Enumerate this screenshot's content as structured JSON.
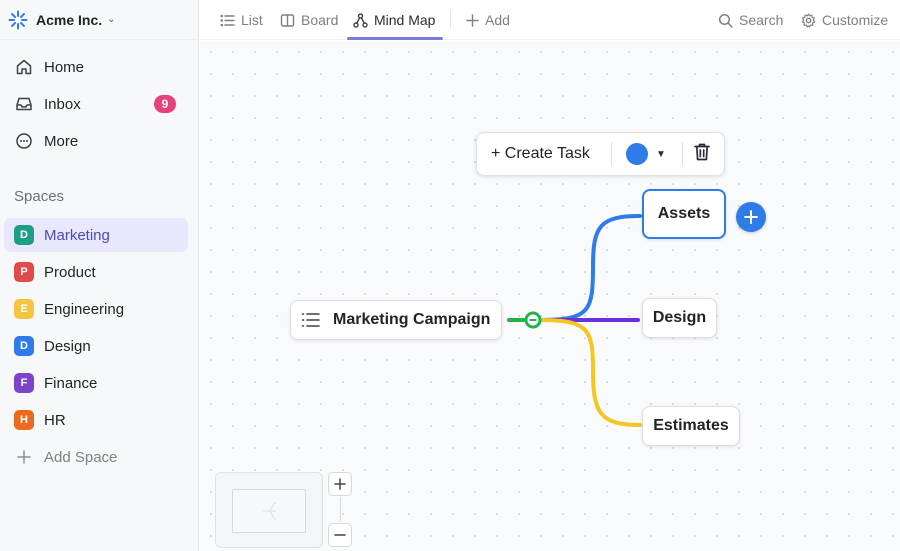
{
  "workspace": {
    "name": "Acme Inc."
  },
  "nav": {
    "home": "Home",
    "inbox": "Inbox",
    "inbox_count": "9",
    "more": "More"
  },
  "spaces": {
    "title": "Spaces",
    "items": [
      {
        "initial": "D",
        "label": "Marketing",
        "color": "#1e9e86"
      },
      {
        "initial": "P",
        "label": "Product",
        "color": "#e04b4b"
      },
      {
        "initial": "E",
        "label": "Engineering",
        "color": "#f5c542"
      },
      {
        "initial": "D",
        "label": "Design",
        "color": "#2f7be7"
      },
      {
        "initial": "F",
        "label": "Finance",
        "color": "#7a45c8"
      },
      {
        "initial": "H",
        "label": "HR",
        "color": "#ec6a1f"
      }
    ],
    "add_label": "Add Space"
  },
  "tabs": {
    "list": "List",
    "board": "Board",
    "mindmap": "Mind Map",
    "add": "Add",
    "search": "Search",
    "customize": "Customize"
  },
  "mindmap": {
    "root": "Marketing Campaign",
    "children": [
      "Assets",
      "Design",
      "Estimates"
    ],
    "toolbar": {
      "create_task": "+ Create Task",
      "color": "#2f7be7"
    },
    "branch_colors": {
      "assets": "#2f7be7",
      "design": "#6d2fd6",
      "estimates": "#f4c623",
      "stem": "#22b14c"
    }
  },
  "colors": {
    "accent": "#7d7ad9",
    "badge": "#e8407a"
  }
}
